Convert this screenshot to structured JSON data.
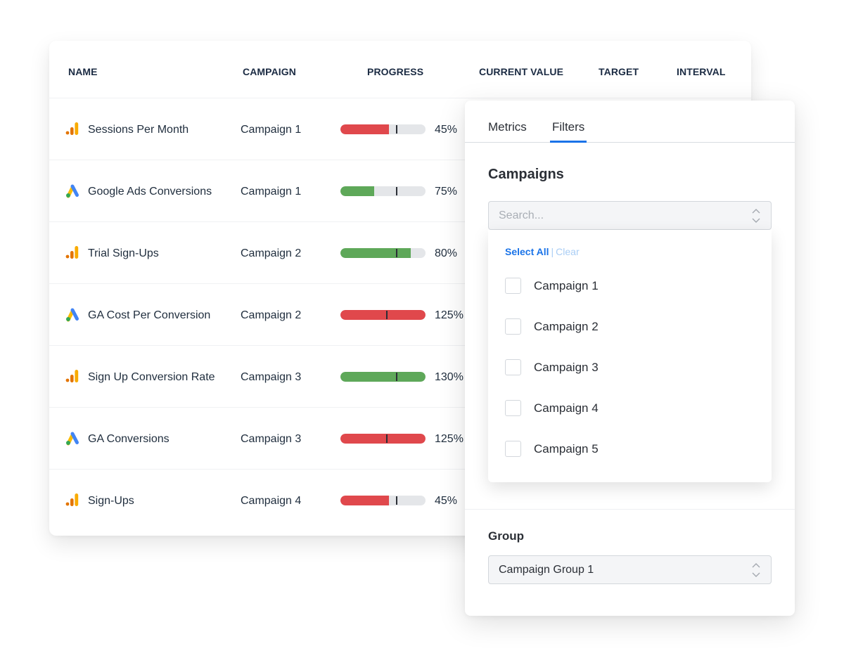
{
  "table": {
    "columns": [
      "NAME",
      "CAMPAIGN",
      "PROGRESS",
      "CURRENT VALUE",
      "TARGET",
      "INTERVAL"
    ],
    "colors": {
      "red": "#e0484c",
      "green": "#5ea859",
      "track": "#e4e6e9"
    },
    "rows": [
      {
        "icon": "google-analytics-icon",
        "name": "Sessions Per Month",
        "campaign": "Campaign 1",
        "progress_label": "45%",
        "bar_fill": 0.57,
        "bar_marker": 0.65,
        "status": "red"
      },
      {
        "icon": "google-ads-icon",
        "name": "Google Ads Conversions",
        "campaign": "Campaign 1",
        "progress_label": "75%",
        "bar_fill": 0.4,
        "bar_marker": 0.65,
        "status": "green"
      },
      {
        "icon": "google-analytics-icon",
        "name": "Trial Sign-Ups",
        "campaign": "Campaign 2",
        "progress_label": "80%",
        "bar_fill": 0.83,
        "bar_marker": 0.65,
        "status": "green"
      },
      {
        "icon": "google-ads-icon",
        "name": "GA Cost Per Conversion",
        "campaign": "Campaign 2",
        "progress_label": "125%",
        "bar_fill": 1.0,
        "bar_marker": 0.54,
        "status": "red"
      },
      {
        "icon": "google-analytics-icon",
        "name": "Sign Up Conversion Rate",
        "campaign": "Campaign 3",
        "progress_label": "130%",
        "bar_fill": 1.0,
        "bar_marker": 0.65,
        "status": "green"
      },
      {
        "icon": "google-ads-icon",
        "name": "GA Conversions",
        "campaign": "Campaign 3",
        "progress_label": "125%",
        "bar_fill": 1.0,
        "bar_marker": 0.54,
        "status": "red"
      },
      {
        "icon": "google-analytics-icon",
        "name": "Sign-Ups",
        "campaign": "Campaign 4",
        "progress_label": "45%",
        "bar_fill": 0.57,
        "bar_marker": 0.65,
        "status": "red"
      }
    ]
  },
  "filter_panel": {
    "tabs": [
      {
        "label": "Metrics",
        "active": false
      },
      {
        "label": "Filters",
        "active": true
      }
    ],
    "campaigns": {
      "title": "Campaigns",
      "search_placeholder": "Search...",
      "search_value": "",
      "select_all_label": "Select All",
      "separator": "|",
      "clear_label": "Clear",
      "options": [
        {
          "label": "Campaign 1",
          "checked": false
        },
        {
          "label": "Campaign 2",
          "checked": false
        },
        {
          "label": "Campaign 3",
          "checked": false
        },
        {
          "label": "Campaign 4",
          "checked": false
        },
        {
          "label": "Campaign 5",
          "checked": false
        }
      ]
    },
    "group": {
      "title": "Group",
      "selected": "Campaign Group 1"
    }
  }
}
